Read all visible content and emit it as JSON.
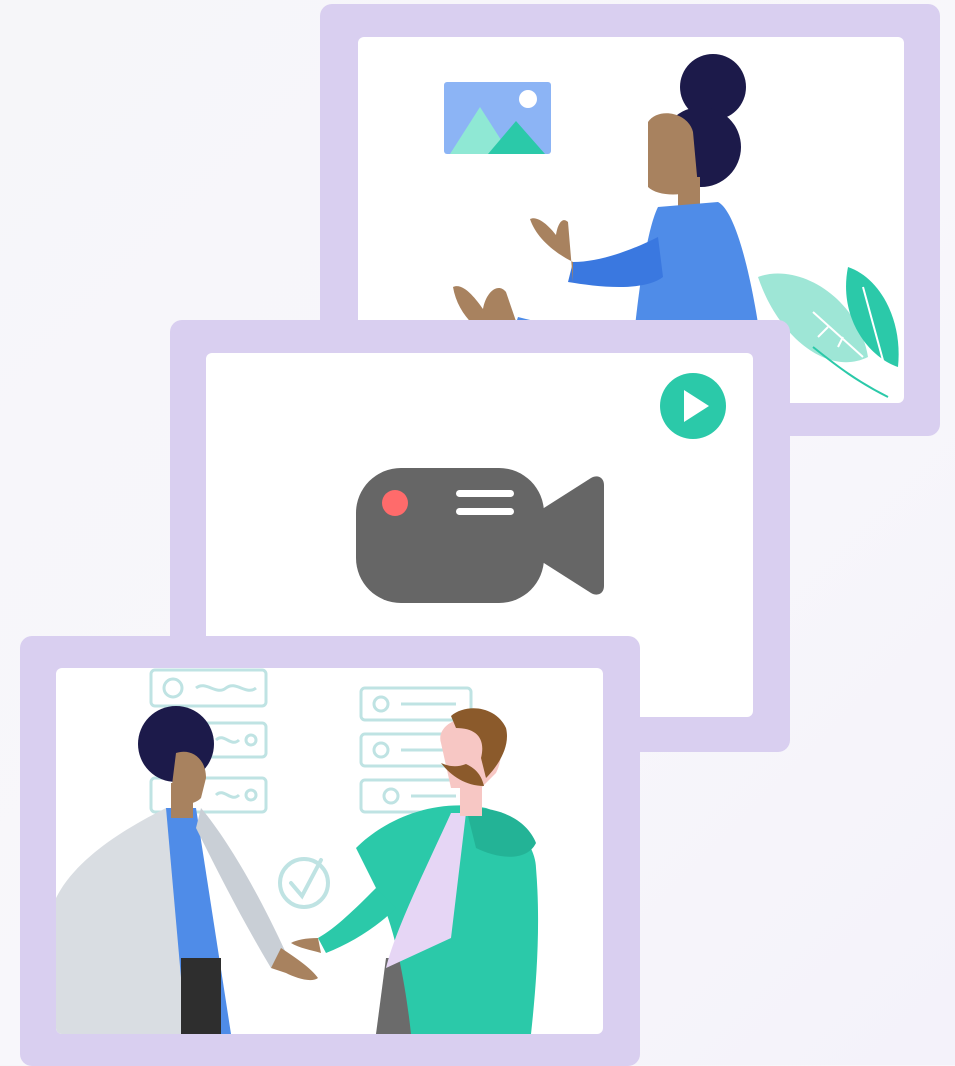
{
  "scene": {
    "palette": {
      "frame": "#d9cff0",
      "panel": "#ffffff",
      "accent_teal": "#2bc9a9",
      "accent_blue": "#4f8ce8",
      "dark_navy": "#1c1a4a",
      "skin": "#a8825f",
      "camera_gray": "#666666",
      "record_dot": "#ff6b6b"
    },
    "cards": [
      {
        "name": "presenter-card",
        "icons": [
          "image-icon",
          "leaf-icon"
        ]
      },
      {
        "name": "video-card",
        "icons": [
          "video-camera-icon",
          "play-button-icon"
        ]
      },
      {
        "name": "meeting-card",
        "icons": [
          "checkmark-circle-icon",
          "list-card-icon"
        ]
      }
    ]
  }
}
